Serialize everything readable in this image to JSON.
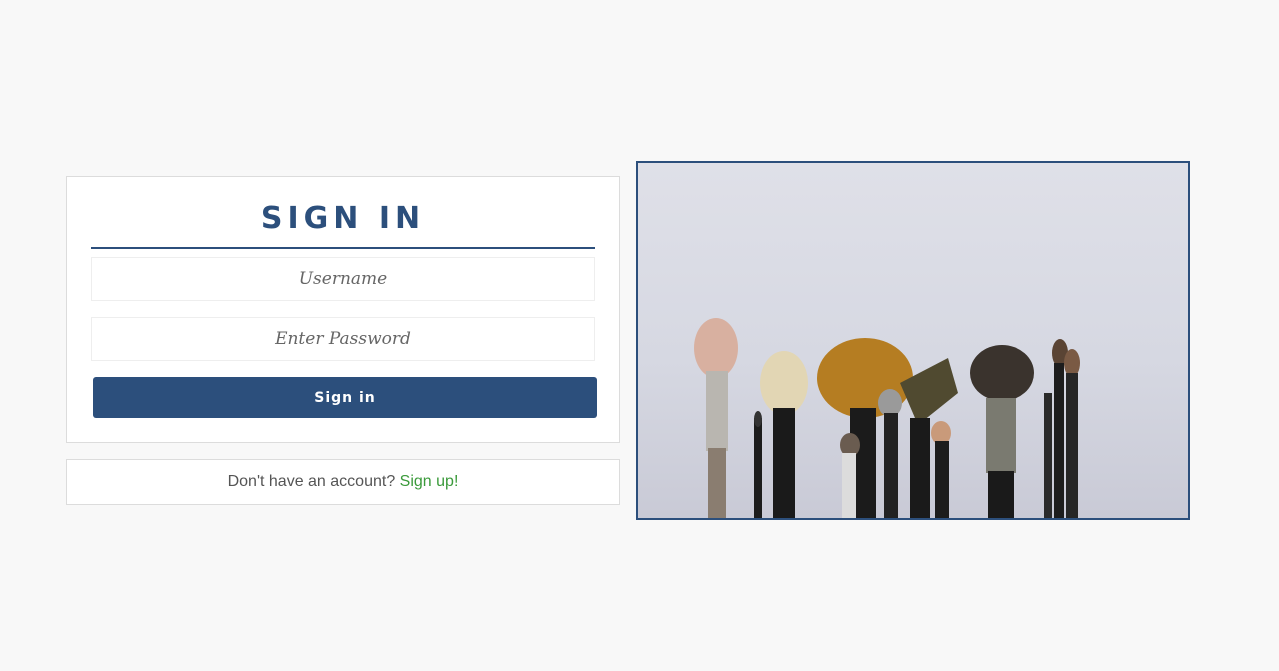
{
  "signin": {
    "title": "SIGN IN",
    "username_placeholder": "Username",
    "password_placeholder": "Enter Password",
    "button_label": "Sign in"
  },
  "signup": {
    "prompt": "Don't have an account?",
    "link_label": "Sign up!"
  },
  "colors": {
    "accent": "#2c4f7c",
    "link": "#3a9a3a",
    "background": "#f8f8f8"
  },
  "image": {
    "subject": "makeup-brushes-photo"
  }
}
